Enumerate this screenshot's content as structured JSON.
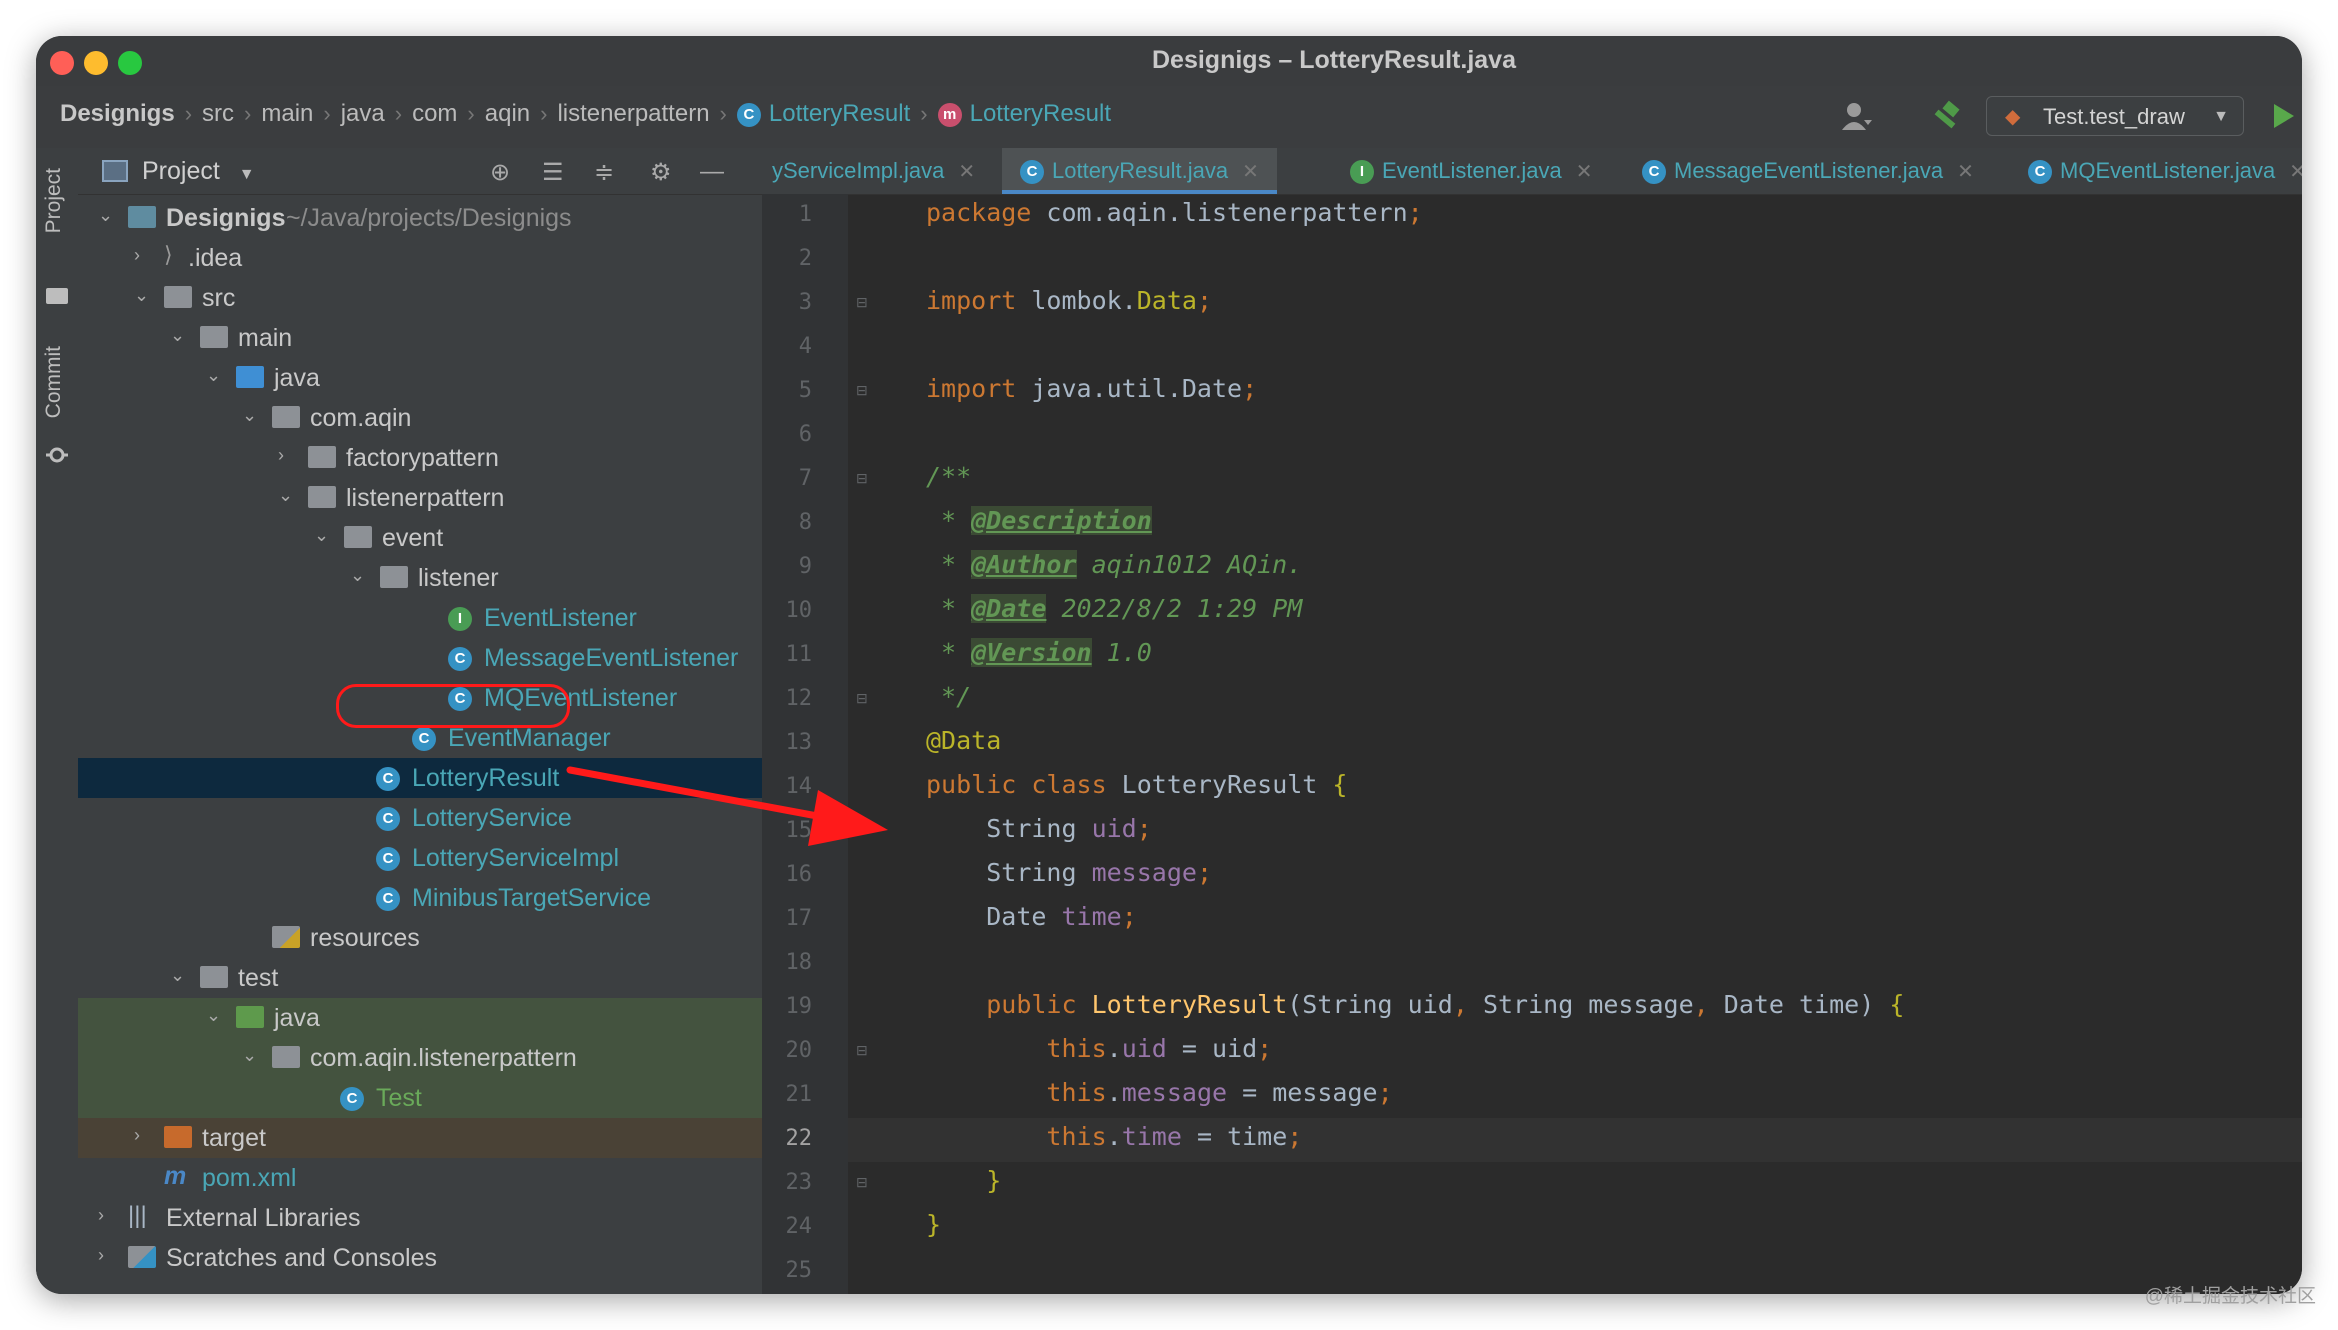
{
  "window": {
    "title": "Designigs – LotteryResult.java"
  },
  "breadcrumb": {
    "items": [
      "Designigs",
      "src",
      "main",
      "java",
      "com",
      "aqin",
      "listenerpattern",
      "LotteryResult",
      "LotteryResult"
    ]
  },
  "toolbar": {
    "run_config": "Test.test_draw"
  },
  "side_strip": {
    "project_label": "Project",
    "commit_label": "Commit"
  },
  "project_panel": {
    "title": "Project",
    "tree": [
      {
        "label": "Designigs",
        "hint": "~/Java/projects/Designigs"
      },
      {
        "label": ".idea"
      },
      {
        "label": "src"
      },
      {
        "label": "main"
      },
      {
        "label": "java"
      },
      {
        "label": "com.aqin"
      },
      {
        "label": "factorypattern"
      },
      {
        "label": "listenerpattern"
      },
      {
        "label": "event"
      },
      {
        "label": "listener"
      },
      {
        "label": "EventListener"
      },
      {
        "label": "MessageEventListener"
      },
      {
        "label": "MQEventListener"
      },
      {
        "label": "EventManager"
      },
      {
        "label": "LotteryResult"
      },
      {
        "label": "LotteryService"
      },
      {
        "label": "LotteryServiceImpl"
      },
      {
        "label": "MinibusTargetService"
      },
      {
        "label": "resources"
      },
      {
        "label": "test"
      },
      {
        "label": "java"
      },
      {
        "label": "com.aqin.listenerpattern"
      },
      {
        "label": "Test"
      },
      {
        "label": "target"
      },
      {
        "label": "pom.xml"
      },
      {
        "label": "External Libraries"
      },
      {
        "label": "Scratches and Consoles"
      }
    ]
  },
  "editor": {
    "tabs": [
      "yServiceImpl.java",
      "LotteryResult.java",
      "EventListener.java",
      "MessageEventListener.java",
      "MQEventListener.java"
    ],
    "active_tab": "LotteryResult.java",
    "current_line": 22,
    "line_numbers": [
      "1",
      "2",
      "3",
      "4",
      "5",
      "6",
      "7",
      "8",
      "9",
      "10",
      "11",
      "12",
      "13",
      "14",
      "15",
      "16",
      "17",
      "18",
      "19",
      "20",
      "21",
      "22",
      "23",
      "24",
      "25"
    ],
    "code": {
      "package_kw": "package",
      "package_name": " com.aqin.listenerpattern",
      "import_kw": "import",
      "import1_pkg": " lombok.",
      "import1_cls": "Data",
      "import2": " java.util.Date",
      "semi": ";",
      "doc_open": "/**",
      "doc_star": " * ",
      "tag_description": "@Description",
      "tag_author": "@Author",
      "author_value": " aqin1012 AQin.",
      "tag_date": "@Date",
      "date_value": " 2022/8/2 1:29 PM",
      "tag_version": "@Version",
      "version_value": " 1.0",
      "doc_close": " */",
      "annotation": "@Data",
      "public_class": "public class",
      "class_name": " LotteryResult ",
      "brace_open": "{",
      "type_string": "String ",
      "type_date": "Date ",
      "field_uid": "uid",
      "field_message": "message",
      "field_time": "time",
      "public_kw": "public ",
      "ctor_name": "LotteryResult",
      "ctor_params_1": "(String uid",
      "comma": ", ",
      "ctor_params_2": "String message",
      "ctor_params_3": "Date time) ",
      "this_kw": "this",
      "dot": ".",
      "assign_uid": " = uid",
      "assign_message": " = message",
      "assign_time": " = time",
      "brace_close": "}"
    }
  },
  "annotation": {
    "highlighted_item": "LotteryResult",
    "circle_color": "#ff1a1a"
  },
  "colors": {
    "keyword": "#cc7832",
    "annotation": "#bbb529",
    "comment": "#629755",
    "field": "#9876aa",
    "method": "#ffc66d",
    "text": "#a9b7c6"
  },
  "watermark": "@稀土掘金技术社区"
}
